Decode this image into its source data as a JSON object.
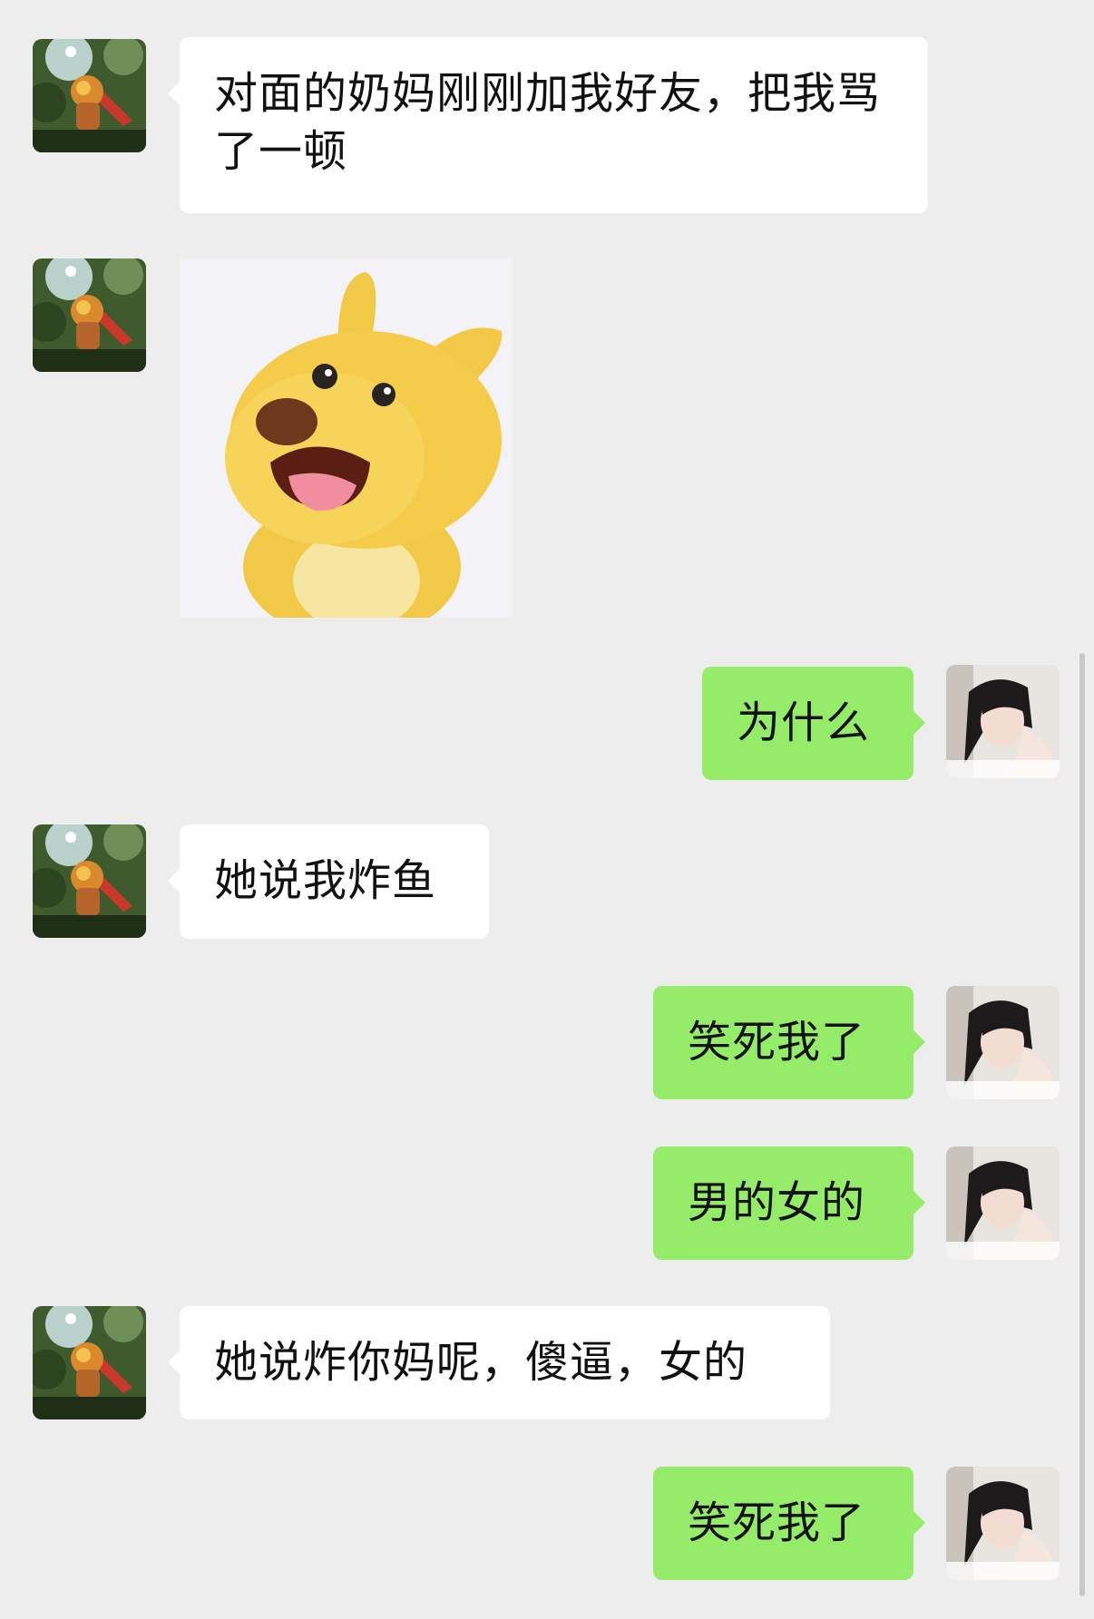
{
  "colors": {
    "background": "#ededed",
    "incoming_bubble": "#ffffff",
    "outgoing_bubble": "#95ec69",
    "text": "#111111"
  },
  "contact": {
    "avatar_icon": "lion-dance-avatar-icon"
  },
  "me": {
    "avatar_icon": "girl-avatar-icon"
  },
  "messages": [
    {
      "from": "contact",
      "type": "text",
      "text": "对面的奶妈刚刚加我好友，把我骂了一顿"
    },
    {
      "from": "contact",
      "type": "sticker",
      "icon": "yellow-dog-sticker-icon"
    },
    {
      "from": "me",
      "type": "text",
      "text": "为什么"
    },
    {
      "from": "contact",
      "type": "text",
      "text": "她说我炸鱼"
    },
    {
      "from": "me",
      "type": "text",
      "text": "笑死我了"
    },
    {
      "from": "me",
      "type": "text",
      "text": "男的女的"
    },
    {
      "from": "contact",
      "type": "text",
      "text": "她说炸你妈呢，傻逼，女的"
    },
    {
      "from": "me",
      "type": "text",
      "text": "笑死我了"
    }
  ]
}
